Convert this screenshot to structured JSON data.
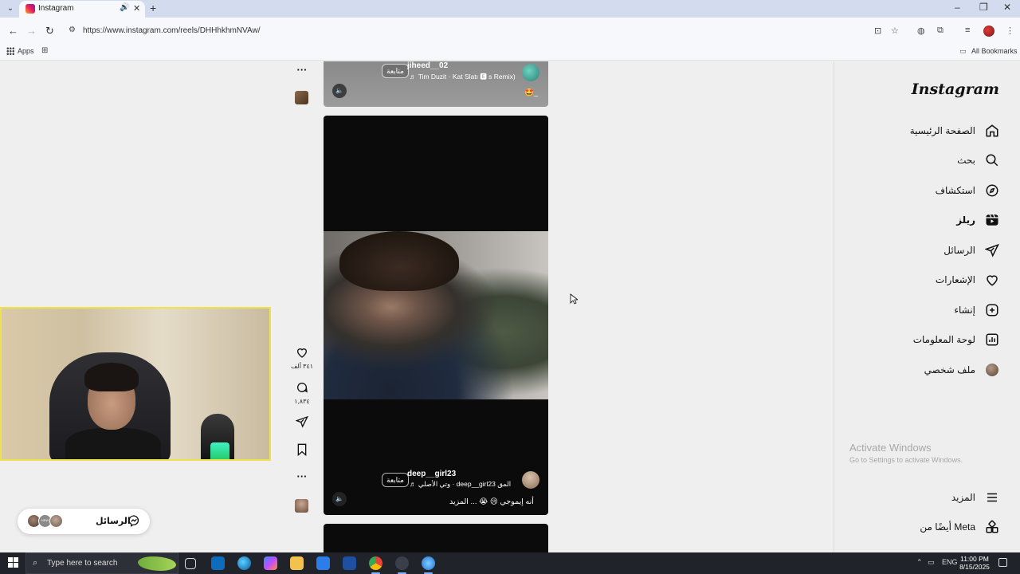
{
  "browser": {
    "tab_title": "Instagram",
    "url": "https://www.instagram.com/reels/DHHhkhmNVAw/",
    "bookmarks_apps": "Apps",
    "bookmarks_all": "All Bookmarks",
    "icons": {
      "tab_menu": "⌄",
      "audio": "🔊",
      "close": "✕",
      "new_tab": "+",
      "minimize": "–",
      "restore": "❐",
      "win_close": "✕",
      "back": "←",
      "forward": "→",
      "reload": "↻",
      "site_info": "⚙",
      "install": "⊡",
      "star": "☆",
      "ext1": "◍",
      "ext2": "⧉",
      "media": "≡",
      "menu": "⋮",
      "apps_grid": "⊞",
      "folder": "▭"
    }
  },
  "reels": {
    "top": {
      "username": "jiheed__02",
      "follow": "متابعة",
      "audio": "♬ Tim Duzit · Kat Slatı 🅴 s Remix)",
      "caption": "🤩_"
    },
    "main": {
      "username": "deep__girl23",
      "follow": "متابعة",
      "audio": "♬ وتي الأصلي · deep__girl23 المق",
      "caption": "أنه إيموجي 😢 😭 ... المزيد"
    },
    "actions": {
      "like_count": "٣٤١ ألف",
      "comment_count": "١,٨٣٤",
      "more": "···"
    },
    "mute_icon": "🔈"
  },
  "nav": {
    "brand": "Instagram",
    "items": [
      {
        "label": "الصفحة الرئيسية",
        "icon": "home-icon"
      },
      {
        "label": "بحث",
        "icon": "search-icon"
      },
      {
        "label": "استكشاف",
        "icon": "compass-icon"
      },
      {
        "label": "ريلز",
        "icon": "reels-icon"
      },
      {
        "label": "الرسائل",
        "icon": "send-icon"
      },
      {
        "label": "الإشعارات",
        "icon": "heart-icon"
      },
      {
        "label": "إنشاء",
        "icon": "plus-icon"
      },
      {
        "label": "لوحة المعلومات",
        "icon": "chart-icon"
      },
      {
        "label": "ملف شخصي",
        "icon": "profile-icon"
      }
    ],
    "more": "المزيد",
    "also_from_meta": "أيضًا من Meta"
  },
  "watermark": {
    "title": "Activate Windows",
    "subtitle": "Go to Settings to activate Windows."
  },
  "messages_pill": {
    "label": "الرسائل",
    "badge": "NEW"
  },
  "taskbar": {
    "search_placeholder": "Type here to search",
    "lang": "ENG",
    "time": "11:00 PM",
    "date": "8/15/2025",
    "tray_up": "⌃",
    "tray_sound": "🔊",
    "tray_net": "▭"
  },
  "colors": {
    "webcam_border": "#f0e24a",
    "taskbar": "#202329",
    "tabbar": "#d3dcef"
  }
}
